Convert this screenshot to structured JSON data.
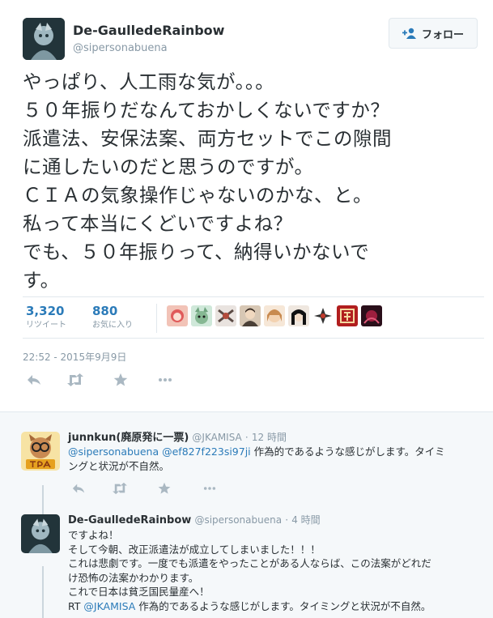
{
  "tweet": {
    "author_name": "De-GaulledeRainbow",
    "author_handle": "@sipersonabuena",
    "follow_label": "フォロー",
    "text_lines": [
      "やっぱり、人工雨な気が。。。",
      "５０年振りだなんておかしくないですか？",
      "派遣法、安保法案、両方セットでこの隙間",
      "に通したいのだと思うのですが。",
      "ＣＩＡの気象操作じゃないのかな、と。",
      "私って本当にくどいですよね？",
      "でも、５０年振りって、納得いかないで",
      "す。"
    ],
    "retweets_count": "3,320",
    "retweets_label": "リツイート",
    "likes_count": "880",
    "likes_label": "お気に入り",
    "timestamp": "22:52 - 2015年9月9日",
    "icons": [
      "reply-icon",
      "retweet-icon",
      "favorite-icon",
      "more-icon"
    ]
  },
  "replies": [
    {
      "author_name": "junnkun(廃原発に一票)",
      "author_handle": "@JKAMISA",
      "time": "12 時間",
      "mention1": "@sipersonabuena",
      "mention2": "@ef827f223si97ji",
      "line1_rest": " 作為的であるような感じがします。タイミ",
      "line2": "ングと状況が不自然。"
    },
    {
      "author_name": "De-GaulledeRainbow",
      "author_handle": "@sipersonabuena",
      "time": "4 時間",
      "lines": [
        "ですよね！",
        "そして今朝、改正派遣法が成立してしまいました！！！",
        "これは悲劇です。一度でも派遣をやったことがある人ならば、この法案がどれだ",
        "け恐怖の法案かわかります。",
        "これで日本は貧乏国民量産へ！"
      ],
      "rt_prefix": "RT ",
      "rt_mention": "@JKAMISA",
      "rt_rest": " 作為的であるような感じがします。タイミングと状況が不自然。"
    }
  ],
  "colors": {
    "link": "#2b7bb9",
    "muted": "#8899a6",
    "text": "#292f33",
    "border": "#e1e8ed",
    "reply_bg": "#f5f8fa"
  }
}
